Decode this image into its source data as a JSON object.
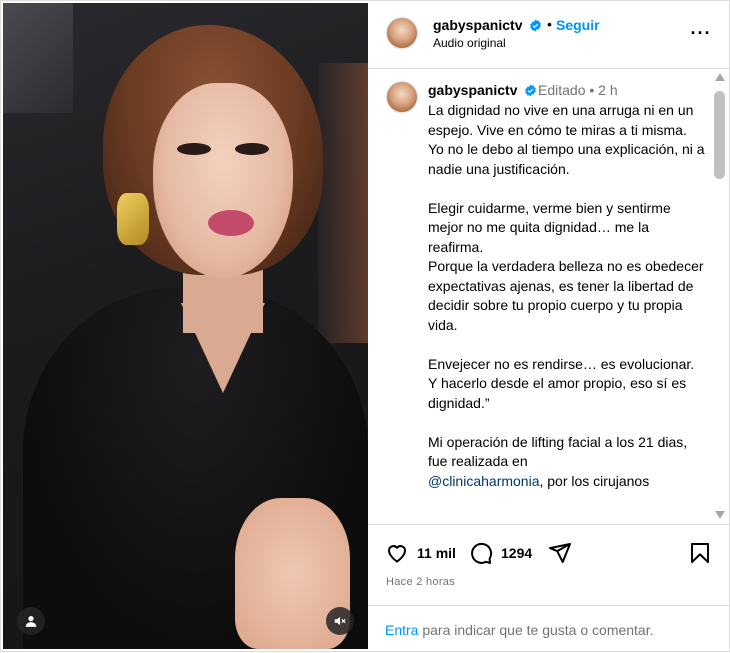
{
  "header": {
    "username": "gabyspanictv",
    "separator": "•",
    "follow_label": "Seguir",
    "audio": "Audio original",
    "more": "···"
  },
  "caption": {
    "username": "gabyspanictv",
    "meta": "Editado  •  2 h",
    "paragraphs": [
      "La dignidad no vive en una arruga ni en un espejo. Vive en cómo te miras a ti misma.",
      "Yo no le debo al tiempo una explicación, ni a nadie una justificación.",
      "",
      "Elegir cuidarme, verme bien y sentirme mejor no me quita dignidad… me la reafirma.",
      "Porque la verdadera belleza no es obedecer expectativas ajenas, es tener la libertad de decidir sobre tu propio cuerpo y tu propia vida.",
      "",
      "Envejecer no es rendirse… es evolucionar.",
      "Y hacerlo desde el amor propio, eso sí es dignidad.”",
      "",
      "Mi operación de lifting facial a los 21 dias, fue realizada en"
    ],
    "last_mention": "@clinicaharmonia",
    "last_tail": ", por los cirujanos"
  },
  "actions": {
    "likes": "11 mil",
    "comments": "1294",
    "time_ago": "Hace 2 horas"
  },
  "login": {
    "link": "Entra",
    "rest": " para indicar que te gusta o comentar."
  },
  "icons": {
    "verified": "verified-badge-icon",
    "heart": "heart-icon",
    "comment": "comment-icon",
    "share": "paper-plane-icon",
    "save": "bookmark-icon",
    "user": "user-icon",
    "mute": "muted-speaker-icon"
  },
  "colors": {
    "accent": "#0095f6",
    "verified": "#0095f6",
    "secondary_text": "#737373",
    "mention": "#00376b"
  }
}
